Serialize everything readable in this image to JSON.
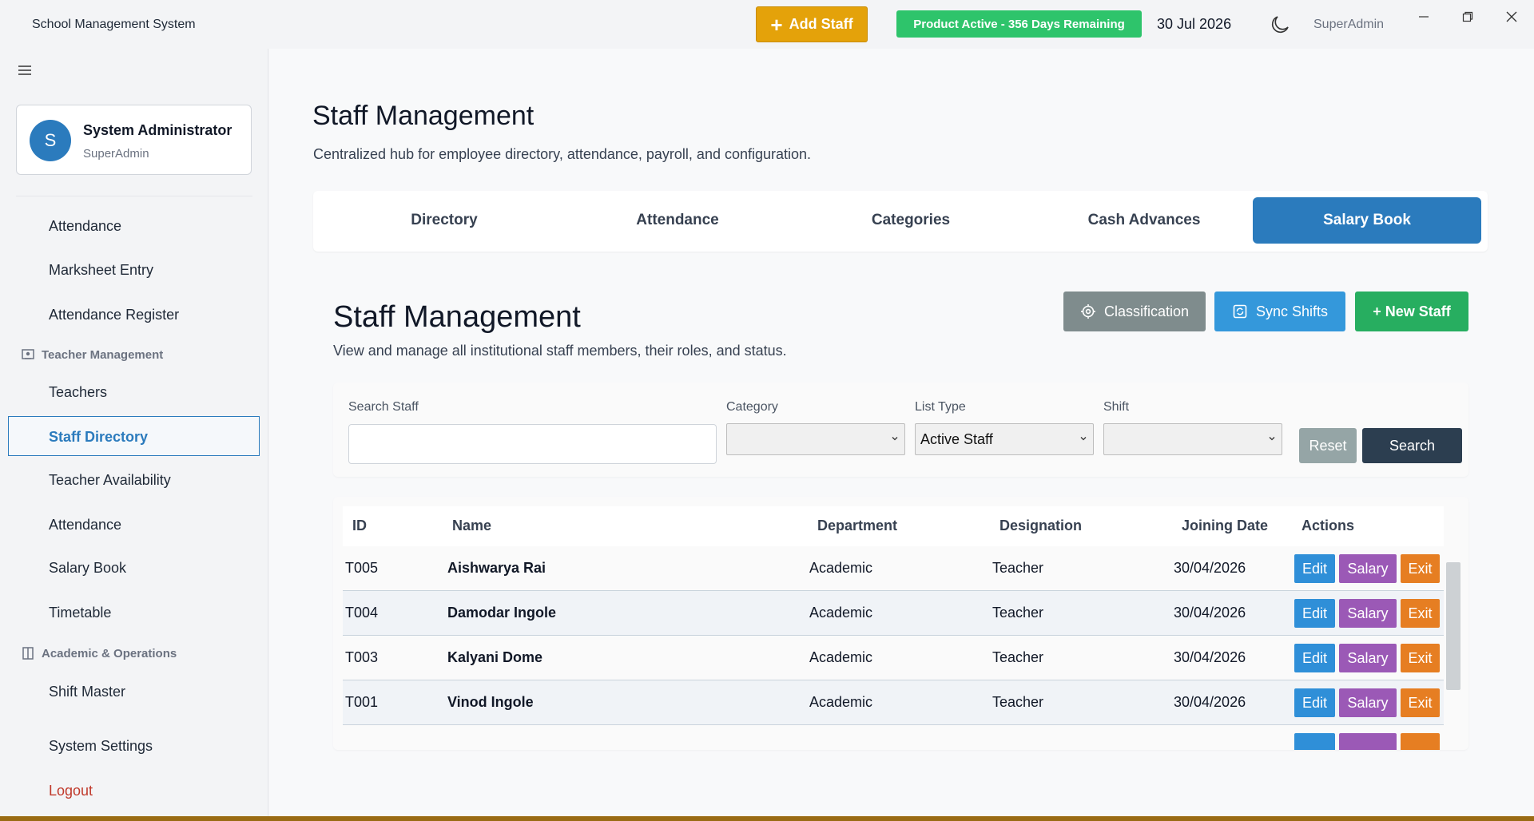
{
  "app": {
    "title": "School Management System",
    "add_staff_label": "Add Staff",
    "product_status": "Product Active - 356 Days Remaining",
    "date": "30 Jul 2026",
    "user_role": "SuperAdmin"
  },
  "sidebar": {
    "profile": {
      "initial": "S",
      "name": "System Administrator",
      "role": "SuperAdmin"
    },
    "items": [
      "Attendance",
      "Marksheet Entry",
      "Attendance Register",
      "Teachers",
      "Staff Directory",
      "Teacher Availability",
      "Attendance",
      "Salary Book",
      "Timetable",
      "Shift Master",
      "System Settings",
      "Logout"
    ],
    "sections": {
      "teacher": "Teacher Management",
      "academic": "Academic & Operations"
    }
  },
  "main": {
    "title": "Staff Management",
    "subtitle": "Centralized hub for employee directory, attendance, payroll, and configuration.",
    "tabs": [
      "Directory",
      "Attendance",
      "Categories",
      "Cash Advances",
      "Salary Book"
    ],
    "active_tab": "Salary Book",
    "section": {
      "title": "Staff Management",
      "subtitle": "View and manage all institutional staff members, their roles, and status.",
      "buttons": {
        "classification": "Classification",
        "sync": "Sync Shifts",
        "new_staff": "+ New Staff"
      }
    },
    "filters": {
      "search_label": "Search Staff",
      "category_label": "Category",
      "list_type_label": "List Type",
      "list_type_value": "Active Staff",
      "shift_label": "Shift",
      "reset_label": "Reset",
      "search_btn_label": "Search"
    },
    "table": {
      "headers": [
        "ID",
        "Name",
        "Department",
        "Designation",
        "Joining Date",
        "Actions"
      ],
      "rows": [
        {
          "id": "T005",
          "name": "Aishwarya  Rai",
          "department": "Academic",
          "designation": "Teacher",
          "joining": "30/04/2026"
        },
        {
          "id": "T004",
          "name": "Damodar Ingole",
          "department": "Academic",
          "designation": "Teacher",
          "joining": "30/04/2026"
        },
        {
          "id": "T003",
          "name": "Kalyani Dome",
          "department": "Academic",
          "designation": "Teacher",
          "joining": "30/04/2026"
        },
        {
          "id": "T001",
          "name": "Vinod Ingole",
          "department": "Academic",
          "designation": "Teacher",
          "joining": "30/04/2026"
        }
      ],
      "row_actions": {
        "edit": "Edit",
        "salary": "Salary",
        "exit": "Exit"
      }
    }
  },
  "colors": {
    "primary": "#2b7bbd",
    "add_staff": "#e4a20a",
    "success": "#2ec46b",
    "edit": "#2f8fd8",
    "salary": "#9b59b6",
    "exit": "#e67e22"
  }
}
